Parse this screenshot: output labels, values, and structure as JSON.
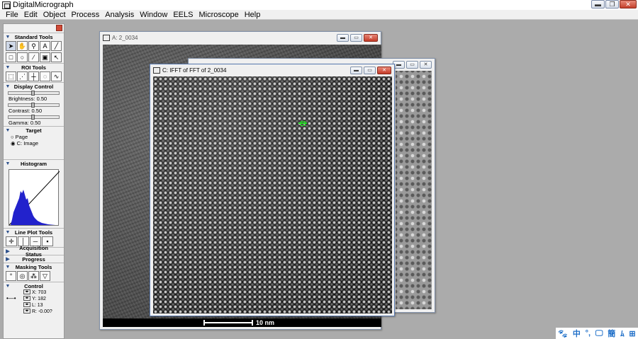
{
  "app": {
    "title": "DigitalMicrograph"
  },
  "menu": [
    "File",
    "Edit",
    "Object",
    "Process",
    "Analysis",
    "Window",
    "EELS",
    "Microscope",
    "Help"
  ],
  "panel": {
    "standard_tools": "Standard Tools",
    "roi_tools": "ROI Tools",
    "display_control": "Display Control",
    "brightness": "Brightness: 0.50",
    "contrast": "Contrast: 0.50",
    "gamma": "Gamma: 0.50",
    "target": "Target",
    "target_page": "Page",
    "target_image": "C: Image",
    "histogram": "Histogram",
    "line_plot_tools": "Line Plot Tools",
    "acquisition_status": "Acquisition Status",
    "progress": "Progress",
    "masking_tools": "Masking Tools",
    "control": "Control",
    "control_values": {
      "x": "X: 703",
      "y": "Y: 182",
      "l": "L: 13",
      "r": "R: -0.00?"
    }
  },
  "windows": {
    "a": {
      "title": "A: 2_0034"
    },
    "c": {
      "title": "C: IFFT of FFT of 2_0034"
    }
  },
  "scalebar": {
    "label": "10 nm"
  },
  "tray": {
    "icons": [
      "🐾",
      "中",
      "°,",
      "🖵",
      "簡",
      "ﾑ",
      "⊞"
    ]
  }
}
